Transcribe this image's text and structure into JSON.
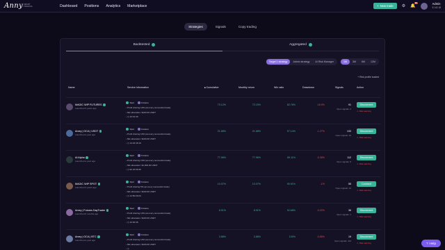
{
  "brand": {
    "logo": "Anny",
    "sub": "SMART TRADING"
  },
  "nav": [
    "Dashboard",
    "Positions",
    "Analytics",
    "Marketplace"
  ],
  "header": {
    "new_trade": "New trade",
    "notif_count": "48",
    "user_name": "Admin",
    "user_balance": "$ 142.18"
  },
  "tabs": [
    "Strategies",
    "Signals",
    "Copy trading"
  ],
  "subtabs": [
    "Backtested",
    "Aggregated"
  ],
  "filters": {
    "strategy": [
      "Target 1 strategy",
      "Admin strategy",
      "AI Risk Manager"
    ],
    "period": [
      "1M",
      "3M",
      "6M",
      "12M"
    ]
  },
  "risk_link": "Risk profile loaded",
  "columns": {
    "name": "Name",
    "service": "Service information",
    "cumulative": "Cumulative",
    "monthly": "Monthly return",
    "winratio": "Win ratio",
    "drawdown": "Drawdown",
    "signals": "Signals",
    "action": "Action"
  },
  "rows": [
    {
      "name": "MAGIC WIP FUTURES",
      "launched": "Launched 3 years ago",
      "spot": "Spot",
      "futures": "Futures",
      "profit": "Profit sharing 10% (at every successful trade)",
      "min": "Min allocation: $100.00 USDT",
      "time": "10:31:30",
      "cumulative": "73.12%",
      "monthly": "72.15%",
      "winratio": "82.76%",
      "drawdown": "-16.9%",
      "signals": "91",
      "open": "Open signals: 2",
      "action": "Disconnect",
      "warn": "Risk warning"
    },
    {
      "name": "Amey | OCA | USDT",
      "launched": "Launched a year ago",
      "spot": "Spot",
      "futures": "Futures",
      "profit": "Profit sharing 10% (at every successful trade)",
      "min": "Min allocation: $100.00 USDT",
      "time": "14:24:48.16",
      "cumulative": "21.68%",
      "monthly": "21.68%",
      "winratio": "97.14%",
      "drawdown": "-1.27%",
      "signals": "133",
      "open": "Open signals: 10",
      "action": "Disconnect",
      "warn": "Risk warning"
    },
    {
      "name": "AI Alpha",
      "launched": "Launched a year ago",
      "spot": "Spot",
      "futures": "Futures",
      "profit": "Profit sharing 10% (at every successful trade)",
      "min": "Min allocation: $1,000.00 USDT",
      "time": "9d 22:00:36",
      "cumulative": "77.96%",
      "monthly": "77.96%",
      "winratio": "89.11%",
      "drawdown": "-0.35%",
      "signals": "112",
      "open": "Open signals: 8",
      "action": "Disconnect",
      "warn": "Risk warning"
    },
    {
      "name": "MAGIC WIP SPOT",
      "launched": "Launched 3 years ago",
      "spot": "Spot",
      "futures": "Futures",
      "profit": "Profit sharing 5% (at every successful trade)",
      "min": "Min allocation: $100.00 USDT",
      "time": "14:50:00.04",
      "cumulative": "10.07%",
      "monthly": "10.07%",
      "winratio": "90.91%",
      "drawdown": "-1%",
      "signals": "55",
      "open": "Open signals: 13",
      "action": "Connect",
      "warn": "Risk warning"
    },
    {
      "name": "Amey | Futures DayTrader",
      "launched": "Launched 6 months ago",
      "spot": "Spot",
      "futures": "Futures",
      "profit": "Profit sharing 10% (at every successful trade)",
      "min": "Min allocation: $100.00 USDT",
      "time": "10:30:38",
      "cumulative": "8.91%",
      "monthly": "8.91%",
      "winratio": "92.68%",
      "drawdown": "-0.22%",
      "signals": "36",
      "open": "Open signals: 1",
      "action": "Disconnect",
      "warn": "Risk warning"
    },
    {
      "name": "Amey | OCA | BTC",
      "launched": "Launched a year ago",
      "spot": "Spot",
      "futures": "Futures",
      "profit": "Profit sharing 10% (at every successful trade)",
      "min": "Min allocation: $100.00 USDT",
      "time": "",
      "cumulative": "3.88%",
      "monthly": "3.88%",
      "winratio": "100%",
      "drawdown": "-0.85%",
      "signals": "19",
      "open": "Open signals: 114",
      "action": "Disconnect",
      "warn": "Risk warning"
    }
  ],
  "help": "Help"
}
